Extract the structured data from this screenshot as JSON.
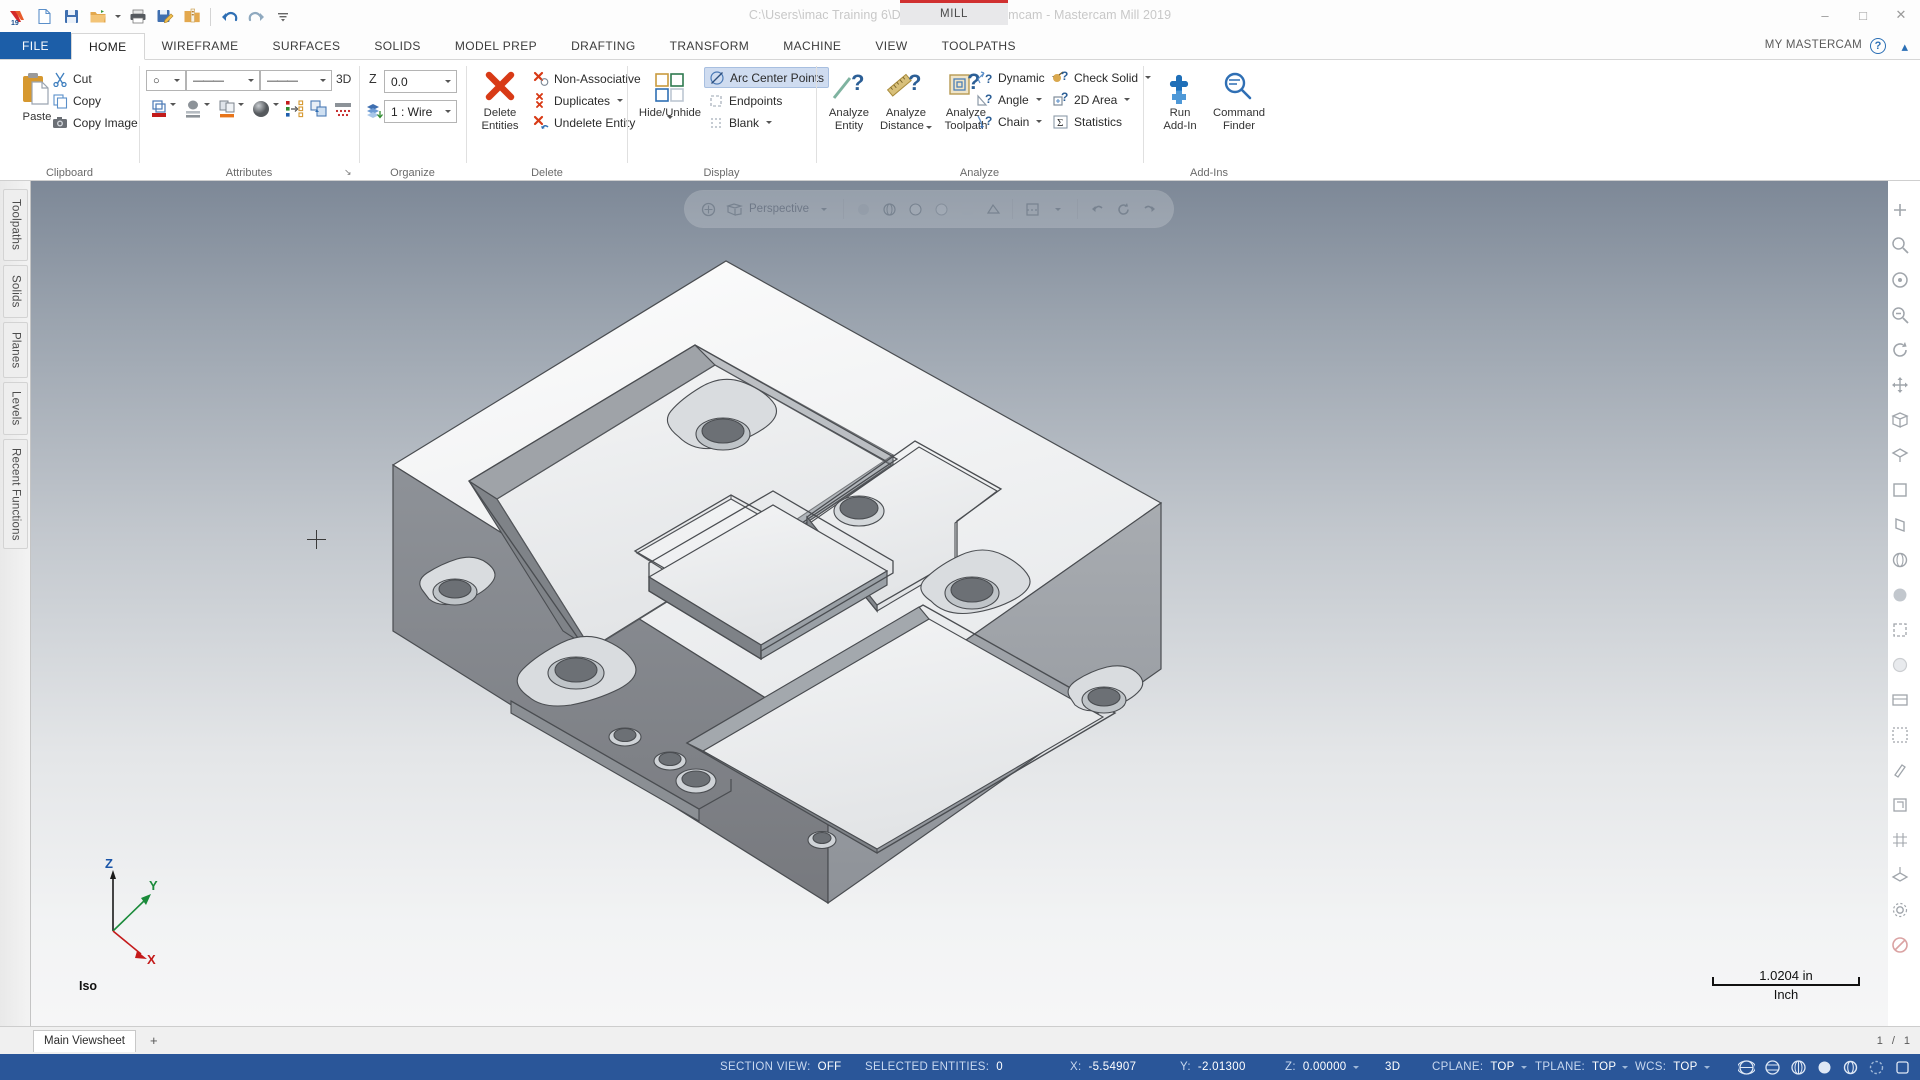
{
  "window": {
    "title": "C:\\Users\\imac Training 6\\Downloads\\1053-21.mcam - Mastercam Mill 2019",
    "machine_tab": "MILL",
    "minimize": "–",
    "maximize": "❐",
    "restore": "□",
    "close": "✕"
  },
  "quick_access": [
    {
      "name": "mastercam-logo-icon",
      "label": "M"
    },
    {
      "name": "new-file-icon",
      "label": "New"
    },
    {
      "name": "save-icon",
      "label": "Save"
    },
    {
      "name": "open-folder-icon",
      "label": "Open"
    },
    {
      "name": "print-icon",
      "label": "Print"
    },
    {
      "name": "save-as-icon",
      "label": "Save As"
    },
    {
      "name": "zip2go-icon",
      "label": "Zip2Go"
    },
    {
      "name": "undo-icon",
      "label": "Undo"
    },
    {
      "name": "redo-icon",
      "label": "Redo"
    },
    {
      "name": "customize-qat-icon",
      "label": "Customize Quick Access Toolbar"
    }
  ],
  "tabs": [
    {
      "label": "FILE",
      "kind": "file"
    },
    {
      "label": "HOME",
      "kind": "active"
    },
    {
      "label": "WIREFRAME",
      "kind": "normal"
    },
    {
      "label": "SURFACES",
      "kind": "normal"
    },
    {
      "label": "SOLIDS",
      "kind": "normal"
    },
    {
      "label": "MODEL PREP",
      "kind": "normal"
    },
    {
      "label": "DRAFTING",
      "kind": "normal"
    },
    {
      "label": "TRANSFORM",
      "kind": "normal"
    },
    {
      "label": "MACHINE",
      "kind": "normal"
    },
    {
      "label": "VIEW",
      "kind": "normal"
    },
    {
      "label": "TOOLPATHS",
      "kind": "normal"
    }
  ],
  "account": {
    "label": "MY MASTERCAM",
    "help": "?"
  },
  "ribbon": {
    "groups": [
      {
        "name": "clipboard",
        "label": "Clipboard"
      },
      {
        "name": "attributes",
        "label": "Attributes"
      },
      {
        "name": "organize",
        "label": "Organize"
      },
      {
        "name": "delete",
        "label": "Delete"
      },
      {
        "name": "display",
        "label": "Display"
      },
      {
        "name": "analyze",
        "label": "Analyze"
      },
      {
        "name": "addins",
        "label": "Add-Ins"
      }
    ],
    "clipboard": {
      "paste": "Paste",
      "cut": "Cut",
      "copy": "Copy",
      "copy_image": "Copy Image"
    },
    "attributes": {
      "point_style": "○",
      "line_style": "———",
      "line_width": "———",
      "mode_3d": "3D",
      "color_label": "Color",
      "level_label": "Level",
      "wire_label": "Wireframe Color",
      "shade_label": "Solid Color",
      "set_all": "Set All",
      "clear_all": "Clear Colors",
      "dialog_launcher": "↘"
    },
    "organize": {
      "z_label": "Z",
      "z_value": "0.0",
      "level_value": "1 : Wire"
    },
    "delete": {
      "delete_entities": "Delete\nEntities",
      "delete_entities_l1": "Delete",
      "delete_entities_l2": "Entities",
      "non_associative": "Non-Associative",
      "duplicates": "Duplicates",
      "undelete_entity": "Undelete Entity"
    },
    "display": {
      "hide_unhide_l1": "Hide/Unhide",
      "arc_center_points": "Arc Center Points",
      "endpoints": "Endpoints",
      "blank": "Blank"
    },
    "analyze": {
      "analyze_entity_l1": "Analyze",
      "analyze_entity_l2": "Entity",
      "analyze_distance_l1": "Analyze",
      "analyze_distance_l2": "Distance",
      "analyze_toolpath_l1": "Analyze",
      "analyze_toolpath_l2": "Toolpath",
      "dynamic": "Dynamic",
      "angle": "Angle",
      "chain": "Chain",
      "check_solid": "Check Solid",
      "area_2d": "2D Area",
      "statistics": "Statistics"
    },
    "addins": {
      "run_addin_l1": "Run",
      "run_addin_l2": "Add-In",
      "command_finder_l1": "Command",
      "command_finder_l2": "Finder"
    }
  },
  "left_panel": {
    "tabs": [
      {
        "label": "Toolpaths",
        "name": "toolpaths"
      },
      {
        "label": "Solids",
        "name": "solids"
      },
      {
        "label": "Planes",
        "name": "planes"
      },
      {
        "label": "Levels",
        "name": "levels"
      },
      {
        "label": "Recent Functions",
        "name": "recent-functions"
      }
    ]
  },
  "viewport": {
    "mini_toolbar_text": "Perspective",
    "gnomon": {
      "x": "X",
      "y": "Y",
      "z": "Z"
    },
    "view_name": "Iso",
    "scale_value": "1.0204 in",
    "scale_unit": "Inch"
  },
  "sheetbar": {
    "tab": "Main Viewsheet",
    "add": "+",
    "page_current": "1",
    "page_total": "1"
  },
  "statusbar": {
    "section_view": {
      "label": "SECTION VIEW:",
      "value": "OFF"
    },
    "selected_entities": {
      "label": "SELECTED ENTITIES:",
      "value": "0"
    },
    "x": {
      "label": "X:",
      "value": "-5.54907"
    },
    "y": {
      "label": "Y:",
      "value": "-2.01300"
    },
    "z": {
      "label": "Z:",
      "value": "0.00000"
    },
    "mode": "3D",
    "cplane": {
      "label": "CPLANE:",
      "value": "TOP"
    },
    "tplane": {
      "label": "TPLANE:",
      "value": "TOP"
    },
    "wcs": {
      "label": "WCS:",
      "value": "TOP"
    }
  },
  "colors": {
    "accent_blue": "#2a5699",
    "file_tab_blue": "#1c5ea8",
    "mill_accent_red": "#d03030",
    "highlight": "#cfdcf0"
  }
}
